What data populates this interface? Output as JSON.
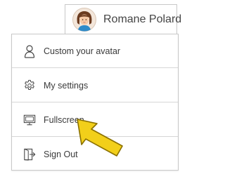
{
  "user": {
    "name": "Romane Polard",
    "avatar_icon": "woman-avatar-icon"
  },
  "menu": {
    "items": [
      {
        "label": "Custom your avatar",
        "icon": "person-icon"
      },
      {
        "label": "My settings",
        "icon": "gear-icon"
      },
      {
        "label": "Fullscreen",
        "icon": "monitor-icon"
      },
      {
        "label": "Sign Out",
        "icon": "sign-out-icon"
      }
    ]
  },
  "colors": {
    "border": "#c8c8c8",
    "text": "#3a3a3a",
    "pointer_arrow": "#f2cf1a",
    "pointer_arrow_outline": "#8a7000"
  }
}
